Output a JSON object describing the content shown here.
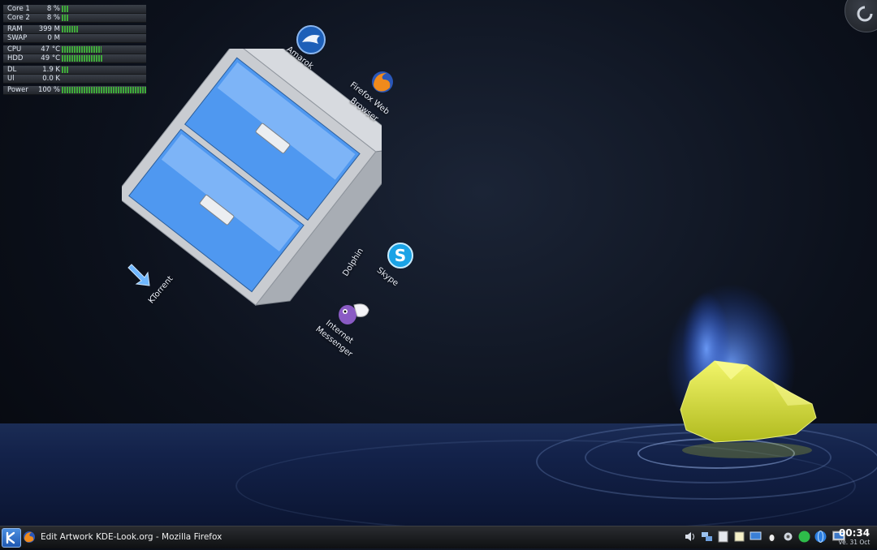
{
  "system_monitor": {
    "groups": [
      {
        "rows": [
          {
            "label": "Core 1",
            "value": "8 %",
            "bar_fraction": 0.08
          },
          {
            "label": "Core 2",
            "value": "8 %",
            "bar_fraction": 0.08
          }
        ]
      },
      {
        "rows": [
          {
            "label": "RAM",
            "value": "399 M",
            "bar_fraction": 0.2
          },
          {
            "label": "SWAP",
            "value": "0 M",
            "bar_fraction": 0.0
          }
        ]
      },
      {
        "rows": [
          {
            "label": "CPU",
            "value": "47 °C",
            "bar_fraction": 0.47
          },
          {
            "label": "HDD",
            "value": "49 °C",
            "bar_fraction": 0.49
          }
        ]
      },
      {
        "rows": [
          {
            "label": "DL",
            "value": "1.9 K",
            "bar_fraction": 0.08
          },
          {
            "label": "Ul",
            "value": "0.0 K",
            "bar_fraction": 0.0
          }
        ]
      },
      {
        "rows": [
          {
            "label": "Power",
            "value": "100 %",
            "bar_fraction": 1.0
          }
        ]
      }
    ]
  },
  "desktop_icons": {
    "amarok": "Amarok",
    "firefox_line1": "Firefox Web",
    "firefox_line2": "Browser",
    "dolphin": "Dolphin",
    "skype": "Skype",
    "ktorrent": "KTorrent",
    "messenger_line1": "Internet",
    "messenger_line2": "Messenger"
  },
  "taskbar": {
    "task_title": "Edit Artwork KDE-Look.org - Mozilla Firefox",
    "clock_time": "00:34",
    "clock_date": "ve. 31 Oct"
  },
  "colors": {
    "desktop_bg": "#0c111c",
    "water": "#13224a",
    "meter_green": "#3faa3a",
    "crystal_yellow": "#d9e23a",
    "flame_blue": "#2f6cff"
  },
  "icons": {
    "kmenu": "kde-logo-icon",
    "task_firefox": "firefox-icon",
    "tray": [
      "volume-icon",
      "network-icon",
      "clipboard-icon",
      "notes-icon",
      "monitor-icon",
      "tux-icon",
      "settings-icon",
      "skype-tray-icon",
      "globe-icon",
      "display-icon"
    ]
  }
}
